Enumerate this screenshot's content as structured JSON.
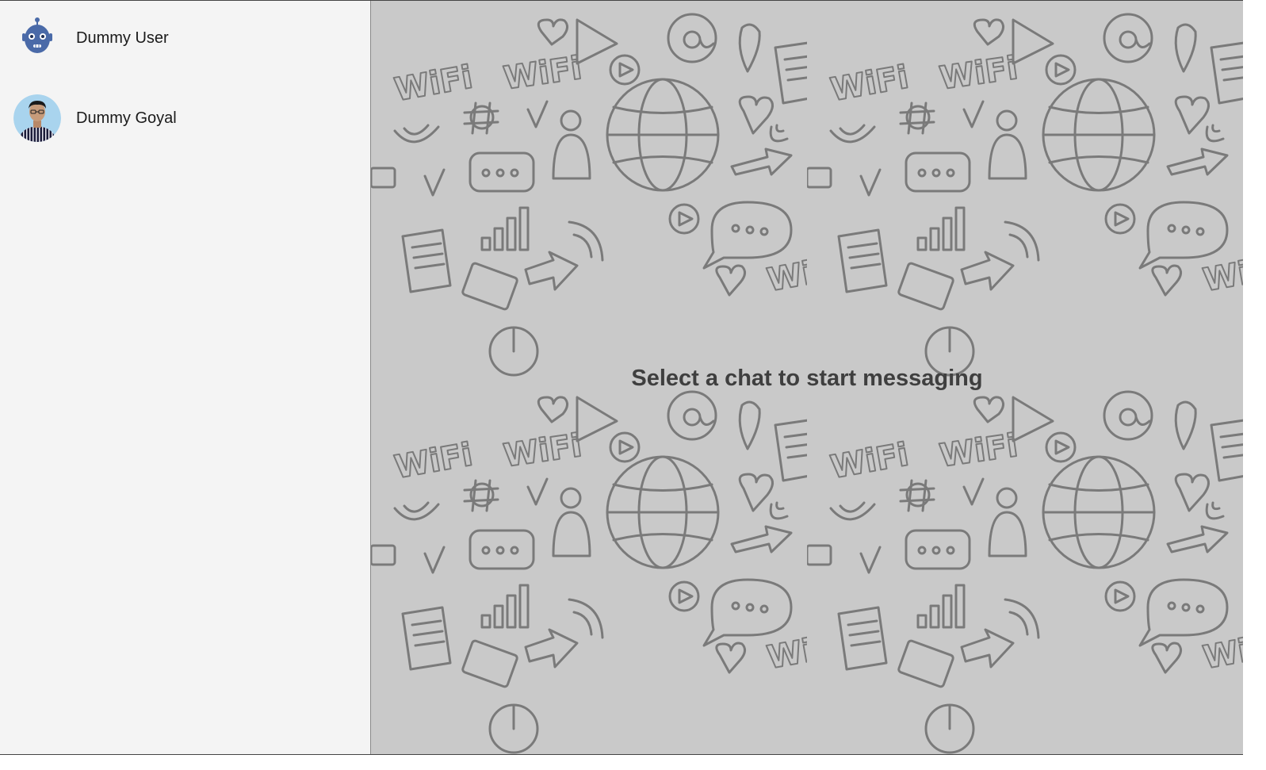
{
  "sidebar": {
    "contacts": [
      {
        "name": "Dummy User",
        "avatar_icon": "robot-avatar-icon"
      },
      {
        "name": "Dummy Goyal",
        "avatar_icon": "person-photo-avatar"
      }
    ]
  },
  "chat": {
    "empty_state_text": "Select a chat to start messaging",
    "background_pattern": "doodle-icons-wallpaper"
  },
  "colors": {
    "sidebar_bg": "#f4f4f4",
    "chat_bg": "#c9c9c9",
    "doodle_stroke": "#7a7a7a",
    "robot_blue": "#4a6aa8"
  }
}
